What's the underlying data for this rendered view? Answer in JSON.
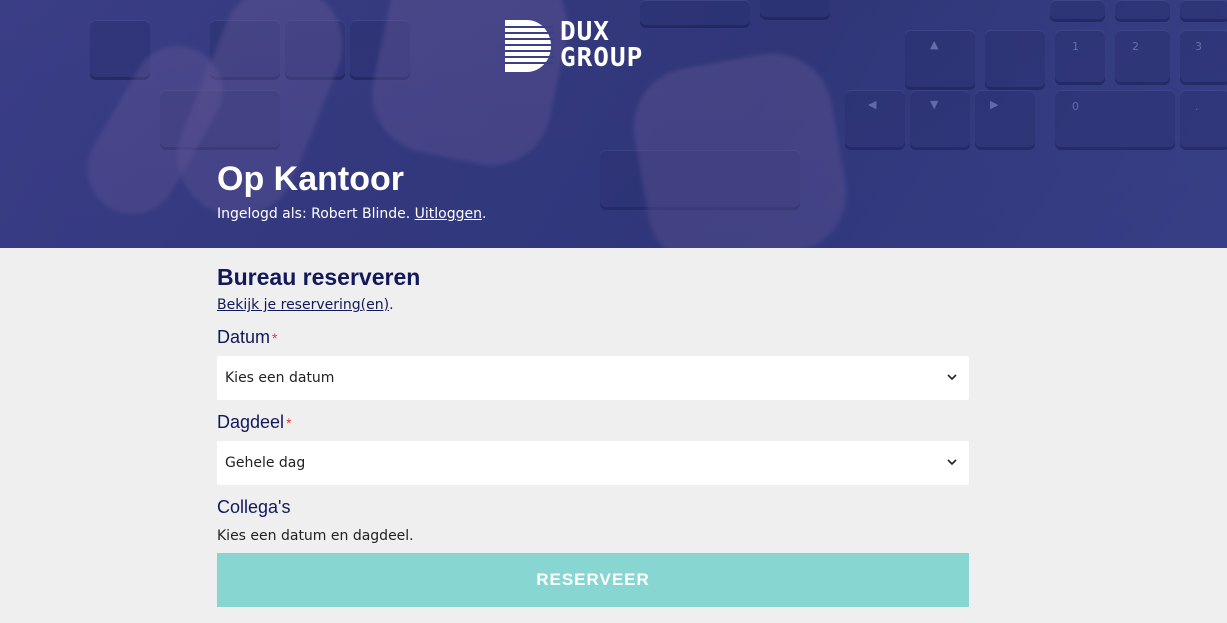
{
  "brand": {
    "logo_line1": "DUX",
    "logo_line2": "GROUP"
  },
  "header": {
    "title": "Op Kantoor",
    "logged_in_prefix": "Ingelogd als: Robert Blinde.",
    "logout_link": "Uitloggen",
    "logout_suffix": "."
  },
  "form": {
    "heading": "Bureau reserveren",
    "reservations_link": "Bekijk je reservering(en)",
    "reservations_suffix": ".",
    "date_label": "Datum",
    "date_required": "*",
    "date_value": "Kies een datum",
    "part_label": "Dagdeel",
    "part_required": "*",
    "part_value": "Gehele dag",
    "colleagues_label": "Collega's",
    "colleagues_helper": "Kies een datum en dagdeel.",
    "submit_label": "RESERVEER"
  },
  "colors": {
    "primary_navy": "#12185a",
    "button_teal": "#88d6d2",
    "required_red": "#e53935",
    "page_bg": "#efefef"
  },
  "icons": {
    "select_arrow": "chevron-down-icon"
  }
}
